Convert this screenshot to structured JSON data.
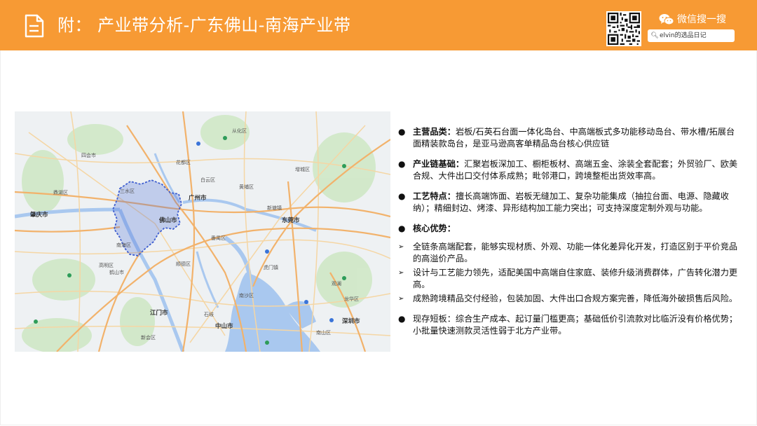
{
  "header": {
    "title": "附：  产业带分析-广东佛山-南海产业带",
    "wechat_label": "微信搜一搜",
    "search_text": "elvin的选品日记",
    "icons": [
      "document-icon",
      "qr-code-icon",
      "wechat-icon",
      "search-icon"
    ]
  },
  "map": {
    "labels": {
      "zhaoqing": "肇庆市",
      "guangzhou": "广州市",
      "foshan": "佛山市",
      "dongguan": "东莞市",
      "jiangmen": "江门市",
      "zhongshan": "中山市",
      "shenzhen": "深圳市",
      "nanhai": "南海区",
      "sanshui": "三水区",
      "gaoming": "高明区",
      "panyu": "番禺区",
      "conghua": "从化区",
      "huadu": "花都区",
      "baiyun": "白云区",
      "huangpu": "黄埔区",
      "zengcheng": "增城区",
      "shunde": "顺德区",
      "heshan": "鹤山市",
      "sihui": "四会市",
      "dinghu": "鼎湖区",
      "xinhui": "新会区",
      "guanlan": "观澜",
      "longhua": "龙华区",
      "nansha": "南沙区",
      "humen": "虎门镇",
      "xintang": "新塘镇",
      "shiqi": "石岐",
      "nanshan": "南山区"
    },
    "colors": {
      "highlight": "#4a6bd6",
      "land": "#eef1f3",
      "water": "#a9c8ef",
      "road_major": "#f2b26b",
      "road_minor": "#f5d6a4",
      "green": "#cfe8c6"
    }
  },
  "content": {
    "b1_label": "主营品类：",
    "b1_text": "岩板/石英石台面一体化岛台、中高端板式多功能移动岛台、带水槽/拓展台面精装款岛台，是亚马逊高客单精品岛台核心供应链",
    "b2_label": "产业链基础：",
    "b2_text": "汇聚岩板深加工、橱柜板材、高端五金、涂装全套配套；外贸验厂、欧美合规、大件出口交付体系成熟；毗邻港口，跨境整柜出货效率高。",
    "b3_label": "工艺特点：",
    "b3_text": "擅长高端饰面、岩板无缝加工、复杂功能集成（抽拉台面、电源、隐藏收纳）；精细封边、烤漆、异形结构加工能力突出；可支持深度定制外观与功能。",
    "b4_label": "核心优势：",
    "subs": [
      "全链条高端配套，能够实现材质、外观、功能一体化差异化开发，打造区别于平价竞品的高溢价产品。",
      "设计与工艺能力领先，适配美国中高端自住家庭、装修升级消费群体，广告转化潜力更高。",
      "成熟跨境精品交付经验，包装加固、大件出口合规方案完善，降低海外破损售后风险。"
    ],
    "b5_text": "现存短板：综合生产成本、起订量门槛更高；基础低价引流款对比临沂没有价格优势；小批量快速测款灵活性弱于北方产业带。",
    "bullet_glyph": "●",
    "arrow_glyph": "➢"
  }
}
